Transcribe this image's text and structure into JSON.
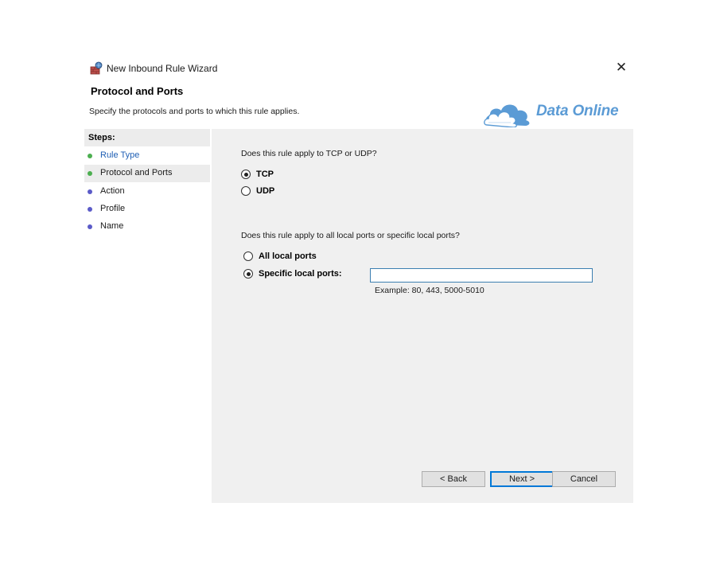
{
  "window": {
    "title": "New Inbound Rule Wizard",
    "close_glyph": "✕",
    "icon": "firewall-wizard-icon"
  },
  "header": {
    "title": "Protocol and Ports",
    "description": "Specify the protocols and ports to which this rule applies."
  },
  "watermark": {
    "text": "Data Online",
    "color": "#5b9bd5"
  },
  "steps": {
    "title": "Steps:",
    "items": [
      {
        "label": "Rule Type",
        "state": "completed",
        "dot_color": "#4caf50"
      },
      {
        "label": "Protocol and Ports",
        "state": "current",
        "dot_color": "#4caf50"
      },
      {
        "label": "Action",
        "state": "pending",
        "dot_color": "#5b5bc8"
      },
      {
        "label": "Profile",
        "state": "pending",
        "dot_color": "#5b5bc8"
      },
      {
        "label": "Name",
        "state": "pending",
        "dot_color": "#5b5bc8"
      }
    ]
  },
  "protocol": {
    "question": "Does this rule apply to TCP or UDP?",
    "options": [
      {
        "label": "TCP",
        "selected": true
      },
      {
        "label": "UDP",
        "selected": false
      }
    ]
  },
  "ports": {
    "question": "Does this rule apply to all local ports or specific local ports?",
    "options": [
      {
        "label": "All local ports",
        "selected": false
      },
      {
        "label": "Specific local ports:",
        "selected": true
      }
    ],
    "input_value": "",
    "example": "Example: 80, 443, 5000-5010"
  },
  "buttons": {
    "back": "< Back",
    "next": "Next >",
    "cancel": "Cancel"
  }
}
